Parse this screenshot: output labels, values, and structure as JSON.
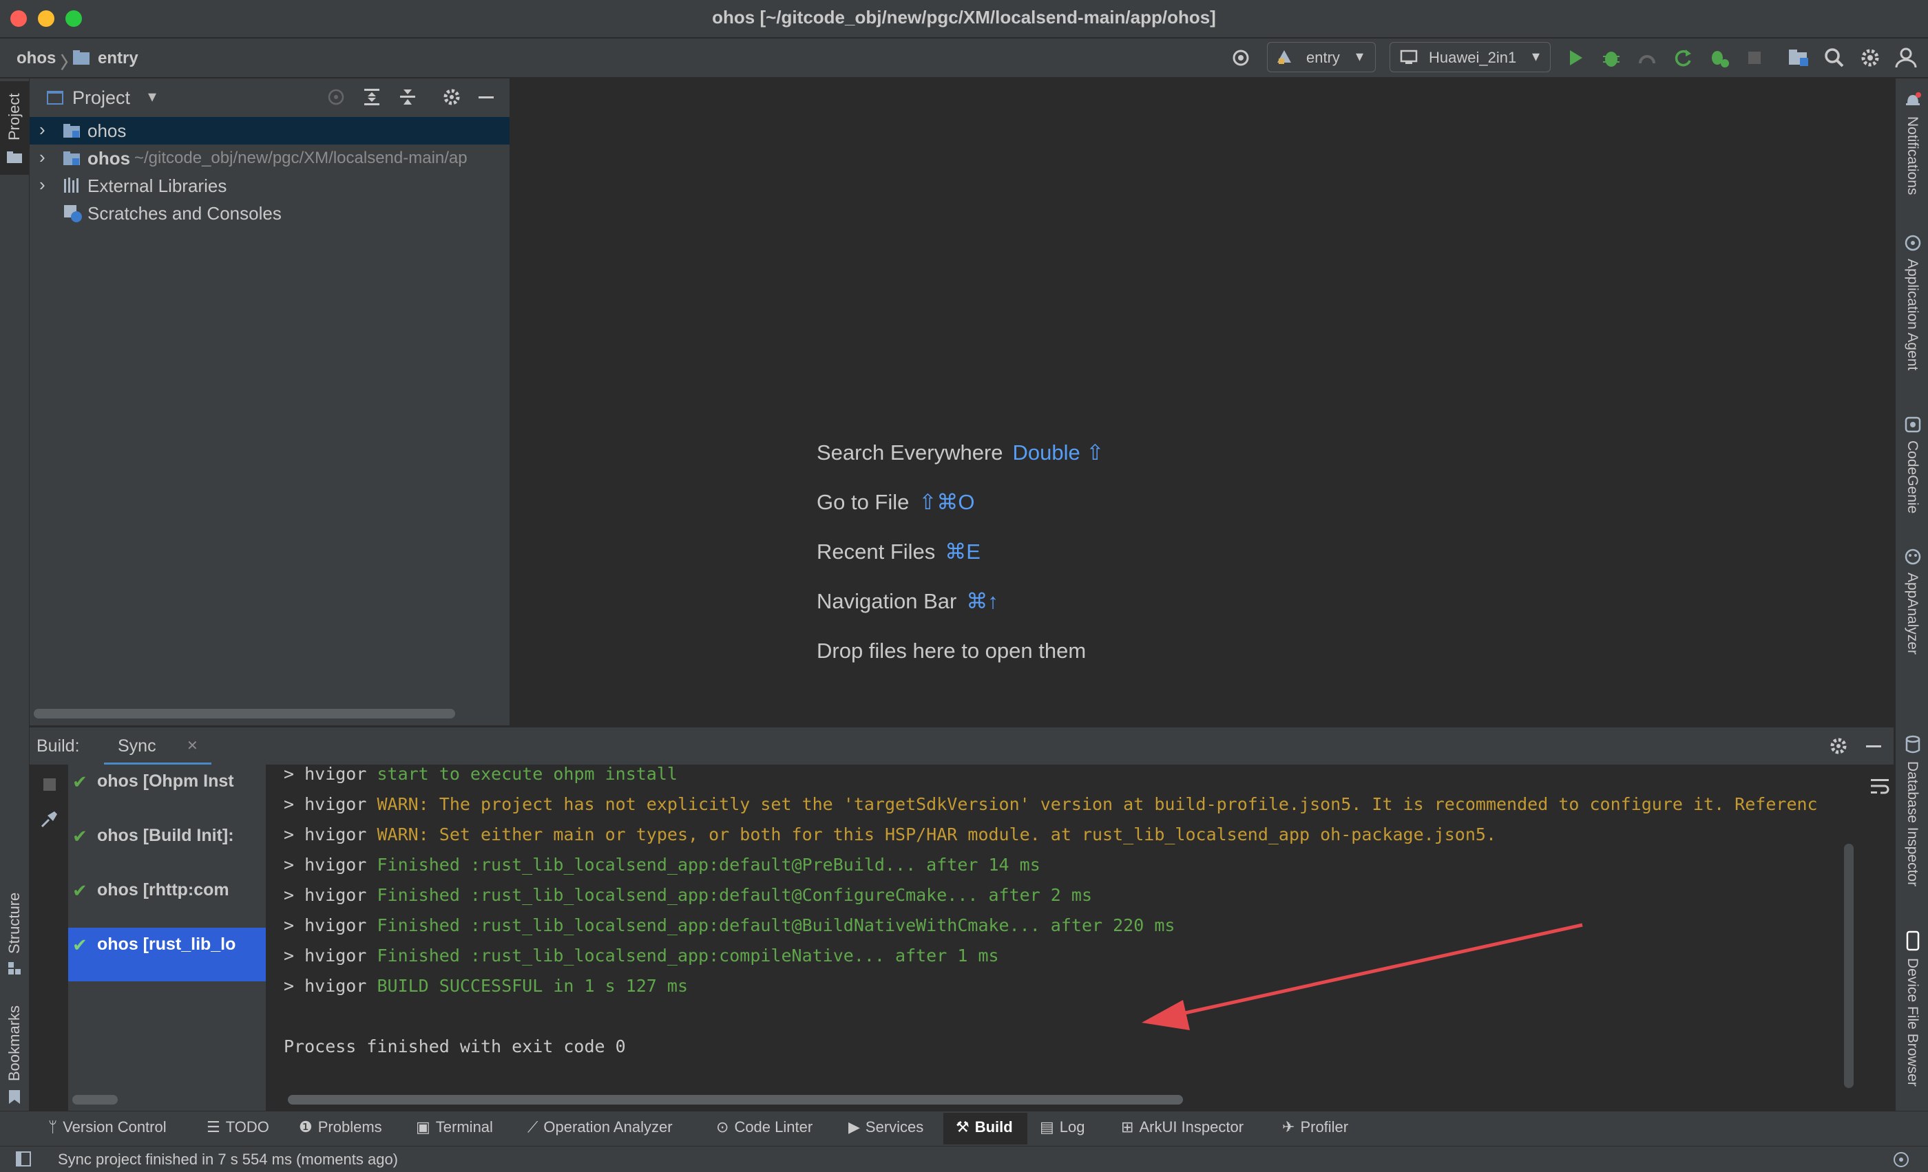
{
  "window": {
    "title": "ohos [~/gitcode_obj/new/pgc/XM/localsend-main/app/ohos]"
  },
  "breadcrumb": {
    "root": "ohos",
    "module": "entry"
  },
  "toolbar": {
    "run_config": "entry",
    "device": "Huawei_2in1"
  },
  "project_panel": {
    "title": "Project",
    "items": [
      {
        "label": "ohos",
        "path": ""
      },
      {
        "label": "ohos",
        "path": "~/gitcode_obj/new/pgc/XM/localsend-main/ap"
      },
      {
        "label": "External Libraries",
        "path": ""
      },
      {
        "label": "Scratches and Consoles",
        "path": ""
      }
    ]
  },
  "left_strip": {
    "project": "Project",
    "structure": "Structure",
    "bookmarks": "Bookmarks"
  },
  "right_strip": {
    "notifications": "Notifications",
    "app_agent": "Application Agent",
    "codegenie": "CodeGenie",
    "appanalyzer": "AppAnalyzer",
    "db_inspector": "Database Inspector",
    "device_browser": "Device File Browser"
  },
  "editor_hints": [
    {
      "label": "Search Everywhere",
      "shortcut": "Double ⇧"
    },
    {
      "label": "Go to File",
      "shortcut": "⇧⌘O"
    },
    {
      "label": "Recent Files",
      "shortcut": "⌘E"
    },
    {
      "label": "Navigation Bar",
      "shortcut": "⌘↑"
    },
    {
      "label": "Drop files here to open them",
      "shortcut": ""
    }
  ],
  "build": {
    "label": "Build:",
    "tab": "Sync",
    "tree": [
      "ohos [Ohpm Inst",
      "ohos [Build Init]:",
      "ohos [rhttp:com",
      "ohos [rust_lib_lo"
    ],
    "console": [
      {
        "prefix": "> hvigor ",
        "text": "start to execute ohpm install",
        "kind": "g"
      },
      {
        "prefix": "> hvigor ",
        "text": "WARN: The project has not explicitly set the 'targetSdkVersion' version at build-profile.json5. It is recommended to configure it. Referenc",
        "kind": "w"
      },
      {
        "prefix": "> hvigor ",
        "text": "WARN: Set either main or types, or both for this HSP/HAR module. at rust_lib_localsend_app oh-package.json5.",
        "kind": "w"
      },
      {
        "prefix": "> hvigor ",
        "text": "Finished :rust_lib_localsend_app:default@PreBuild... after 14 ms",
        "kind": "g"
      },
      {
        "prefix": "> hvigor ",
        "text": "Finished :rust_lib_localsend_app:default@ConfigureCmake... after 2 ms",
        "kind": "g"
      },
      {
        "prefix": "> hvigor ",
        "text": "Finished :rust_lib_localsend_app:default@BuildNativeWithCmake... after 220 ms",
        "kind": "g"
      },
      {
        "prefix": "> hvigor ",
        "text": "Finished :rust_lib_localsend_app:compileNative... after 1 ms",
        "kind": "g"
      },
      {
        "prefix": "> hvigor ",
        "text": "BUILD SUCCESSFUL in 1 s 127 ms",
        "kind": "g"
      }
    ],
    "exit_line": "Process finished with exit code 0"
  },
  "tool_windows": [
    "Version Control",
    "TODO",
    "Problems",
    "Terminal",
    "Operation Analyzer",
    "Code Linter",
    "Services",
    "Build",
    "Log",
    "ArkUI Inspector",
    "Profiler"
  ],
  "status": {
    "text": "Sync project finished in 7 s 554 ms (moments ago)"
  },
  "colors": {
    "background": "#2b2b2b",
    "panel": "#3c3f41",
    "accent_blue": "#589df6",
    "success_green": "#5fa74a",
    "warn_yellow": "#c59a32",
    "annotation_red": "#e5484d",
    "selection": "#2e5fd7"
  }
}
